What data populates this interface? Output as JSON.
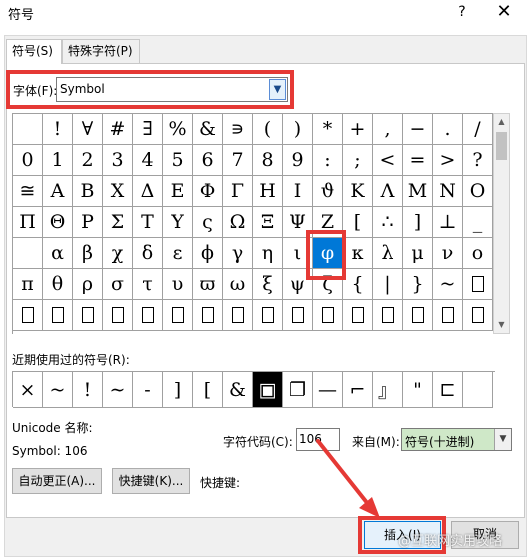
{
  "window": {
    "title": "符号",
    "help_label": "?",
    "close_label": "✕"
  },
  "tabs": [
    {
      "label": "符号(S)",
      "active": true
    },
    {
      "label": "特殊字符(P)",
      "active": false
    }
  ],
  "font": {
    "label": "字体(F):",
    "value": "Symbol"
  },
  "grid": {
    "rows": [
      [
        "",
        "!",
        "∀",
        "#",
        "∃",
        "%",
        "&",
        "∍",
        "(",
        ")",
        "*",
        "+",
        ",",
        "−",
        ".",
        "/"
      ],
      [
        "0",
        "1",
        "2",
        "3",
        "4",
        "5",
        "6",
        "7",
        "8",
        "9",
        ":",
        ";",
        "<",
        "=",
        ">",
        "?"
      ],
      [
        "≅",
        "Α",
        "Β",
        "Χ",
        "Δ",
        "Ε",
        "Φ",
        "Γ",
        "Η",
        "Ι",
        "ϑ",
        "Κ",
        "Λ",
        "Μ",
        "Ν",
        "Ο"
      ],
      [
        "Π",
        "Θ",
        "Ρ",
        "Σ",
        "Τ",
        "Υ",
        "ς",
        "Ω",
        "Ξ",
        "Ψ",
        "Ζ",
        "[",
        "∴",
        "]",
        "⊥",
        "_"
      ],
      [
        "",
        "α",
        "β",
        "χ",
        "δ",
        "ε",
        "ϕ",
        "γ",
        "η",
        "ι",
        "φ",
        "κ",
        "λ",
        "μ",
        "ν",
        "ο"
      ],
      [
        "π",
        "θ",
        "ρ",
        "σ",
        "τ",
        "υ",
        "ϖ",
        "ω",
        "ξ",
        "ψ",
        "ζ",
        "{",
        "|",
        "}",
        "~",
        "□"
      ],
      [
        "□",
        "□",
        "□",
        "□",
        "□",
        "□",
        "□",
        "□",
        "□",
        "□",
        "□",
        "□",
        "□",
        "□",
        "□",
        "□"
      ]
    ],
    "selected": "φ"
  },
  "recent": {
    "label": "近期使用过的符号(R):",
    "items": [
      "×",
      "~",
      "!",
      "∼",
      "-",
      "]",
      "[",
      "&",
      "▣",
      "❐",
      "—",
      "⌐",
      "』",
      "\"",
      "⊏",
      ""
    ]
  },
  "info": {
    "unicode_name_label": "Unicode 名称:",
    "symbol_code": "Symbol: 106",
    "char_code_label": "字符代码(C):",
    "char_code_value": "106",
    "from_label": "来自(M):",
    "from_value": "符号(十进制)"
  },
  "buttons": {
    "autocorrect": "自动更正(A)...",
    "shortcut_key": "快捷键(K)...",
    "shortcut_label": "快捷键:",
    "insert": "插入(I)",
    "cancel": "取消"
  },
  "watermark": "@互联网实用攻略",
  "colors": {
    "selection": "#0078d7",
    "annotation": "#e53935",
    "from_select_bg": "#cfe8c8"
  }
}
